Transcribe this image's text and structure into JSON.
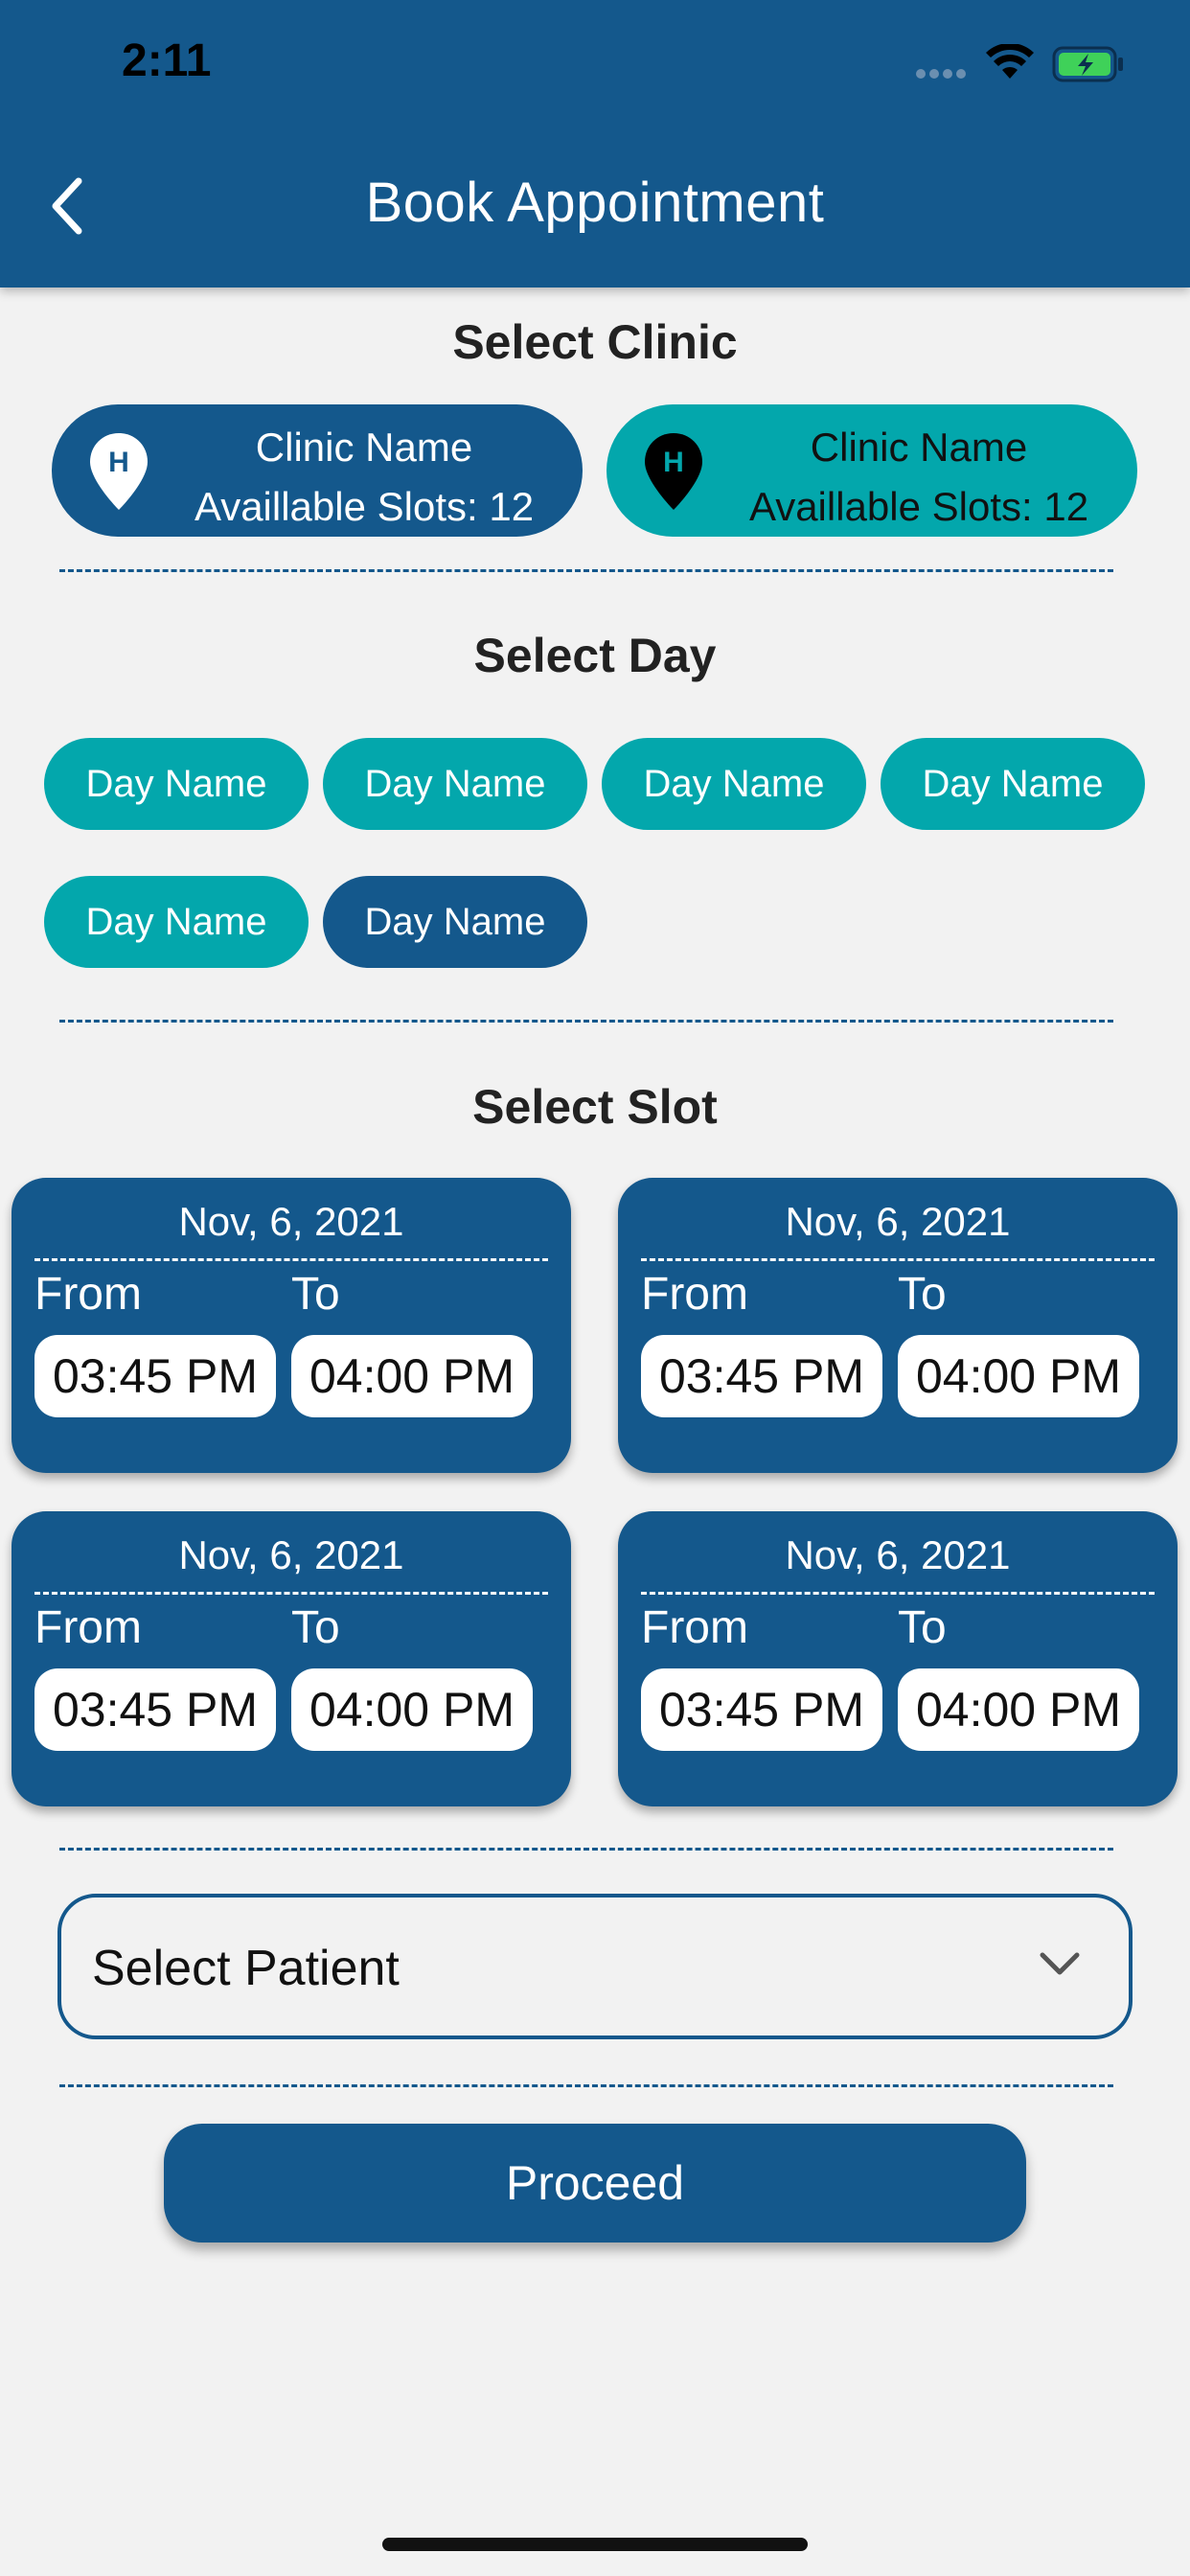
{
  "status_bar": {
    "time": "2:11"
  },
  "header": {
    "title": "Book Appointment"
  },
  "clinic_section": {
    "title": "Select Clinic",
    "clinics": [
      {
        "name": "Clinic Name",
        "slots": "Availlable Slots: 12"
      },
      {
        "name": "Clinic Name",
        "slots": "Availlable Slots: 12"
      }
    ]
  },
  "day_section": {
    "title": "Select Day",
    "days": [
      "Day Name",
      "Day Name",
      "Day Name",
      "Day Name",
      "Day Name",
      "Day Name"
    ]
  },
  "slot_section": {
    "title": "Select Slot",
    "slots": [
      {
        "date": "Nov, 6, 2021",
        "from_label": "From",
        "to_label": "To",
        "from": "03:45 PM",
        "to": "04:00 PM"
      },
      {
        "date": "Nov, 6, 2021",
        "from_label": "From",
        "to_label": "To",
        "from": "03:45 PM",
        "to": "04:00 PM"
      },
      {
        "date": "Nov, 6, 2021",
        "from_label": "From",
        "to_label": "To",
        "from": "03:45 PM",
        "to": "04:00 PM"
      },
      {
        "date": "Nov, 6, 2021",
        "from_label": "From",
        "to_label": "To",
        "from": "03:45 PM",
        "to": "04:00 PM"
      }
    ]
  },
  "patient_select": {
    "label": "Select Patient"
  },
  "proceed_button": {
    "label": "Proceed"
  },
  "colors": {
    "primary": "#14588c",
    "accent": "#03a7ac",
    "background": "#f2f2f2"
  }
}
